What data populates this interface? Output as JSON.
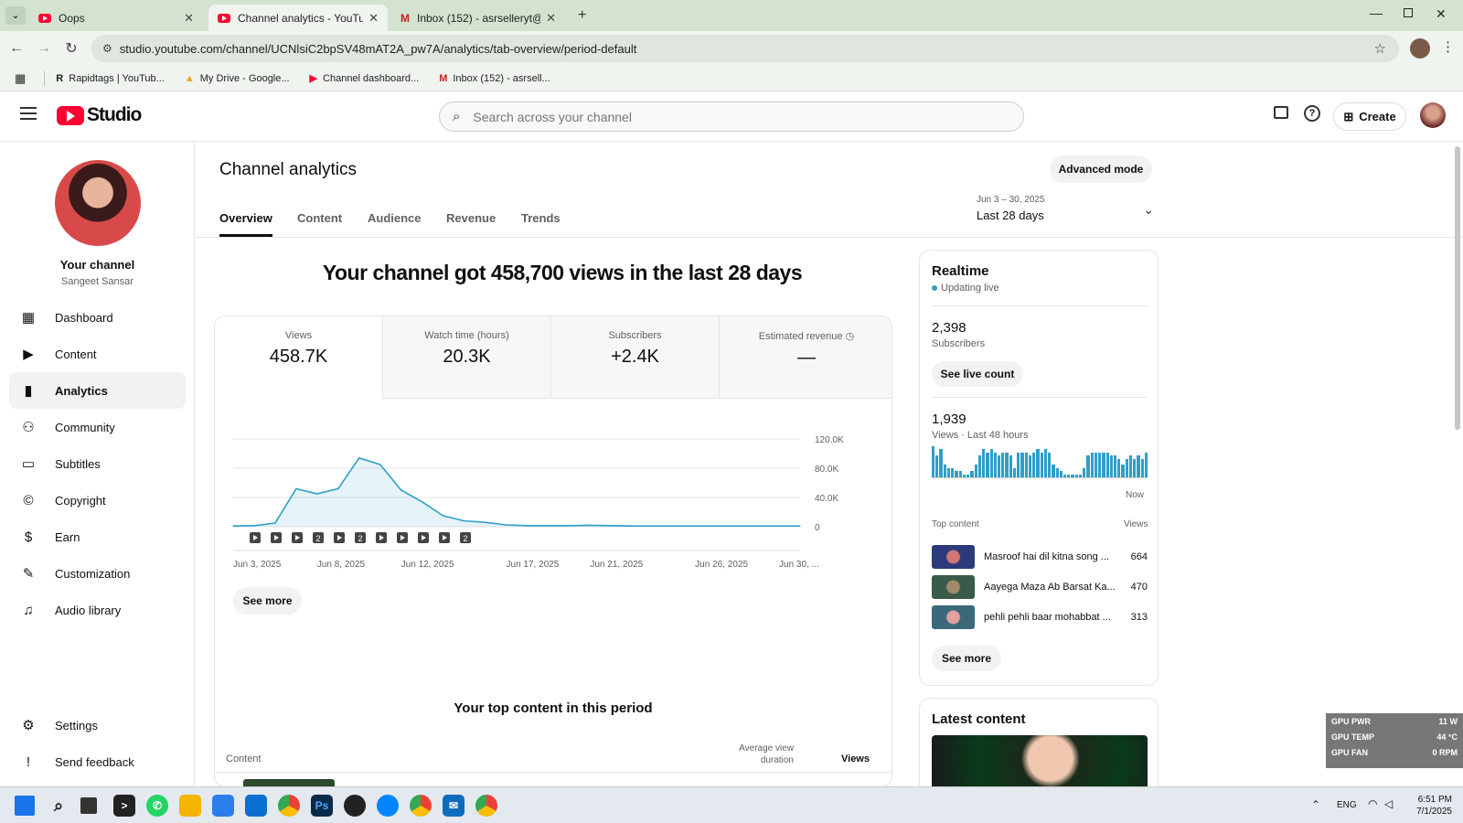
{
  "browser": {
    "tabs": [
      {
        "title": "Oops",
        "active": false,
        "icon": "youtube-icon"
      },
      {
        "title": "Channel analytics - YouTube Studio",
        "active": true,
        "icon": "youtube-icon"
      },
      {
        "title": "Inbox (152) - asrselleryt@gmail.com",
        "active": false,
        "icon": "gmail-icon"
      }
    ],
    "url": "studio.youtube.com/channel/UCNlsiC2bpSV48mAT2A_pw7A/analytics/tab-overview/period-default",
    "bookmarks": [
      {
        "label": "Rapidtags | YouTub...",
        "icon": "R"
      },
      {
        "label": "My Drive - Google...",
        "icon": "drive-icon"
      },
      {
        "label": "Channel dashboard...",
        "icon": "youtube-icon"
      },
      {
        "label": "Inbox (152) - asrsell...",
        "icon": "gmail-icon"
      }
    ]
  },
  "header": {
    "logo_text": "Studio",
    "search_placeholder": "Search across your channel",
    "create_label": "Create"
  },
  "sidebar": {
    "channel_title": "Your channel",
    "channel_name": "Sangeet Sansar",
    "items": [
      {
        "label": "Dashboard",
        "icon": "dashboard-icon",
        "active": false
      },
      {
        "label": "Content",
        "icon": "content-icon",
        "active": false
      },
      {
        "label": "Analytics",
        "icon": "analytics-icon",
        "active": true
      },
      {
        "label": "Community",
        "icon": "community-icon",
        "active": false
      },
      {
        "label": "Subtitles",
        "icon": "subtitles-icon",
        "active": false
      },
      {
        "label": "Copyright",
        "icon": "copyright-icon",
        "active": false
      },
      {
        "label": "Earn",
        "icon": "earn-icon",
        "active": false
      },
      {
        "label": "Customization",
        "icon": "customization-icon",
        "active": false
      },
      {
        "label": "Audio library",
        "icon": "audio-library-icon",
        "active": false
      }
    ],
    "settings_label": "Settings",
    "feedback_label": "Send feedback"
  },
  "analytics": {
    "title": "Channel analytics",
    "advanced_mode_label": "Advanced mode",
    "tabs": [
      "Overview",
      "Content",
      "Audience",
      "Revenue",
      "Trends"
    ],
    "date_range": "Jun 3 – 30, 2025",
    "period_label": "Last 28 days",
    "headline": "Your channel got 458,700 views in the last 28 days",
    "metrics": [
      {
        "label": "Views",
        "value": "458.7K"
      },
      {
        "label": "Watch time (hours)",
        "value": "20.3K"
      },
      {
        "label": "Subscribers",
        "value": "+2.4K"
      },
      {
        "label": "Estimated revenue",
        "value": "—"
      }
    ],
    "see_more_label": "See more",
    "top_content_title": "Your top content in this period",
    "table_headers": {
      "content": "Content",
      "avd": "Average view duration",
      "views": "Views"
    }
  },
  "chart_data": {
    "type": "area",
    "x": [
      "Jun 3",
      "Jun 4",
      "Jun 5",
      "Jun 6",
      "Jun 7",
      "Jun 8",
      "Jun 9",
      "Jun 10",
      "Jun 11",
      "Jun 12",
      "Jun 13",
      "Jun 14",
      "Jun 15",
      "Jun 16",
      "Jun 17",
      "Jun 18",
      "Jun 19",
      "Jun 20",
      "Jun 21",
      "Jun 22",
      "Jun 23",
      "Jun 24",
      "Jun 25",
      "Jun 26",
      "Jun 27",
      "Jun 28",
      "Jun 29",
      "Jun 30"
    ],
    "values": [
      1000,
      1500,
      5000,
      52000,
      45000,
      52000,
      94000,
      85000,
      50000,
      34000,
      15000,
      8000,
      6000,
      2500,
      1500,
      1500,
      1500,
      2000,
      1500,
      1000,
      1000,
      1000,
      1000,
      1000,
      1000,
      1000,
      1000,
      1000
    ],
    "x_tick_labels": [
      "Jun 3, 2025",
      "Jun 8, 2025",
      "Jun 12, 2025",
      "Jun 17, 2025",
      "Jun 21, 2025",
      "Jun 26, 2025",
      "Jun 30, ..."
    ],
    "x_tick_days": [
      3,
      7,
      11,
      16,
      20,
      25,
      29
    ],
    "y_tick_labels": [
      "120.0K",
      "80.0K",
      "40.0K",
      "0"
    ],
    "ylim": [
      0,
      120000
    ],
    "grid": true,
    "color": "#2f9fc8",
    "markers": [
      "",
      "",
      "",
      "2",
      "",
      "2",
      "",
      "",
      "",
      "",
      "2"
    ]
  },
  "realtime": {
    "title": "Realtime",
    "status": "Updating live",
    "subscribers_value": "2,398",
    "subscribers_label": "Subscribers",
    "see_live_count_label": "See live count",
    "views_value": "1,939",
    "views_label": "Views · Last 48 hours",
    "now_label": "Now",
    "bars": [
      10,
      7,
      9,
      4,
      3,
      3,
      2,
      2,
      1,
      1,
      2,
      4,
      7,
      9,
      8,
      9,
      8,
      7,
      8,
      8,
      7,
      3,
      8,
      8,
      8,
      7,
      8,
      9,
      8,
      9,
      8,
      4,
      3,
      2,
      1,
      1,
      1,
      1,
      1,
      3,
      7,
      8,
      8,
      8,
      8,
      8,
      7,
      7,
      6,
      4,
      6,
      7,
      6,
      7,
      6,
      8
    ],
    "top_content_label": "Top content",
    "views_col_label": "Views",
    "top_content": [
      {
        "title": "Masroof hai dil kitna song ...",
        "views": "664"
      },
      {
        "title": "Aayega Maza Ab Barsat Ka...",
        "views": "470"
      },
      {
        "title": "pehli pehli baar mohabbat ...",
        "views": "313"
      }
    ],
    "see_more_label": "See more"
  },
  "latest_content": {
    "title": "Latest content"
  },
  "overlay": {
    "gpu": [
      {
        "label": "GPU PWR",
        "value": "11 W"
      },
      {
        "label": "GPU TEMP",
        "value": "44 °C"
      },
      {
        "label": "GPU FAN",
        "value": "0 RPM"
      }
    ]
  },
  "taskbar": {
    "language": "ENG",
    "time": "6:51 PM",
    "date": "7/1/2025"
  }
}
